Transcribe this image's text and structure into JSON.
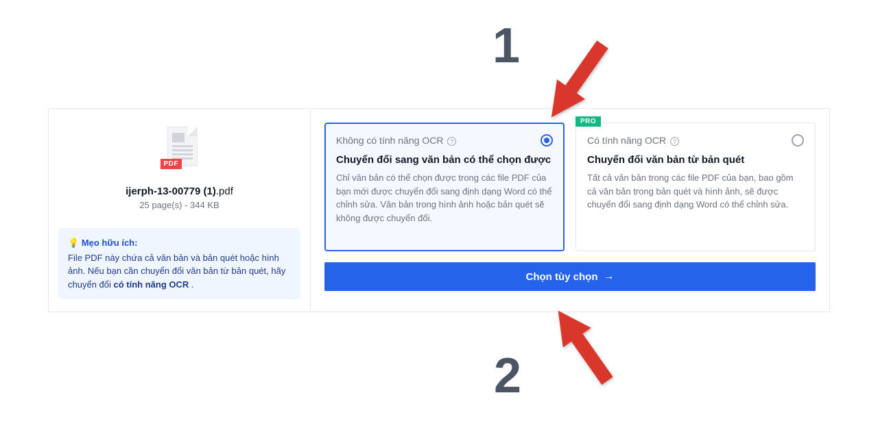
{
  "file": {
    "name": "ijerph-13-00779 (1)",
    "ext": ".pdf",
    "meta": "25 page(s) - 344 KB",
    "badge": "PDF"
  },
  "tip": {
    "icon": "💡",
    "title": "Mẹo hữu ích:",
    "text_pre": "File PDF này chứa cả văn bản và bản quét hoặc hình ảnh. Nếu bạn cần chuyển đổi văn bản từ bản quét, hãy chuyển đổi ",
    "text_bold": "có tính năng OCR",
    "text_post": " ."
  },
  "options": [
    {
      "label": "Không có tính năng OCR",
      "title": "Chuyển đổi sang văn bản có thể chọn được",
      "desc": "Chỉ văn bản có thể chọn được trong các file PDF của bạn mới được chuyển đổi sang định dạng Word có thể chỉnh sửa. Văn bản trong hình ảnh hoặc bản quét sẽ không được chuyển đổi."
    },
    {
      "label": "Có tính năng OCR",
      "title": "Chuyển đổi văn bản từ bản quét",
      "desc": "Tất cả văn bản trong các file PDF của bạn, bao gồm cả văn bản trong bản quét và hình ảnh, sẽ được chuyển đổi sang định dạng Word có thể chỉnh sửa.",
      "pro": "PRO"
    }
  ],
  "cta_label": "Chọn tùy chọn",
  "annotations": {
    "num1": "1",
    "num2": "2"
  }
}
